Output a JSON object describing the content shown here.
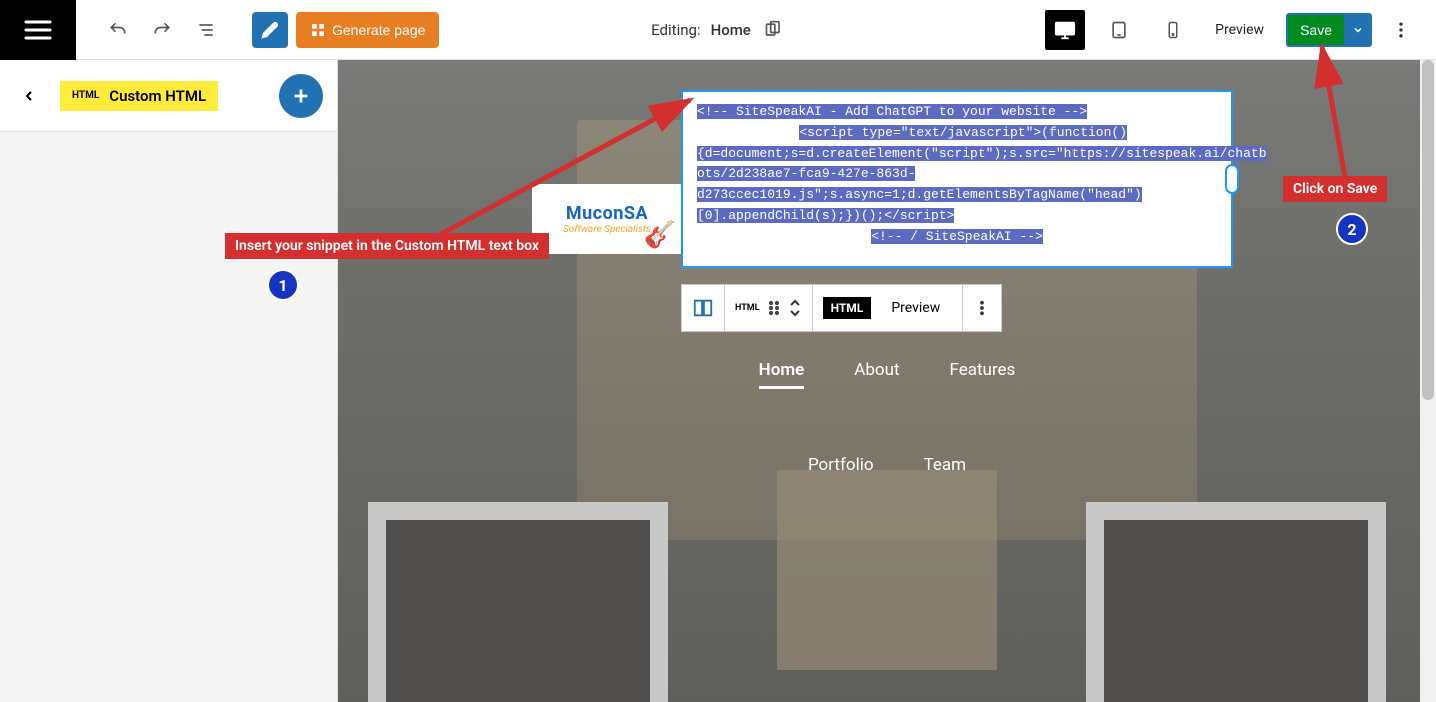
{
  "topbar": {
    "generate_label": "Generate page",
    "editing_label": "Editing:",
    "page_name": "Home",
    "preview_label": "Preview",
    "save_label": "Save"
  },
  "sidebar": {
    "block_type_tag": "HTML",
    "block_type_label": "Custom HTML"
  },
  "canvas": {
    "logo_line1": "MuconSA",
    "logo_line2": "Software Specialists",
    "code": {
      "l1": "<!-- SiteSpeakAI - Add ChatGPT to your website -->",
      "l2": "<script type=\"text/javascript\">(function()",
      "l3": "{d=document;s=d.createElement(\"script\");s.src=\"https://sitespeak.ai/chatb",
      "l4": "ots/2d238ae7-fca9-427e-863d-",
      "l5": "d273ccec1019.js\";s.async=1;d.getElementsByTagName(\"head\")",
      "l6": "[0].appendChild(s);})();</script>",
      "l7": "<!-- / SiteSpeakAI -->"
    },
    "block_toolbar": {
      "html_mini": "HTML",
      "html_dark": "HTML",
      "preview": "Preview"
    },
    "nav": {
      "home": "Home",
      "about": "About",
      "features": "Features",
      "portfolio": "Portfolio",
      "team": "Team"
    }
  },
  "annotations": {
    "step1_text": "Insert your snippet in the Custom HTML text box",
    "step1_num": "1",
    "step2_text": "Click on Save",
    "step2_num": "2"
  }
}
